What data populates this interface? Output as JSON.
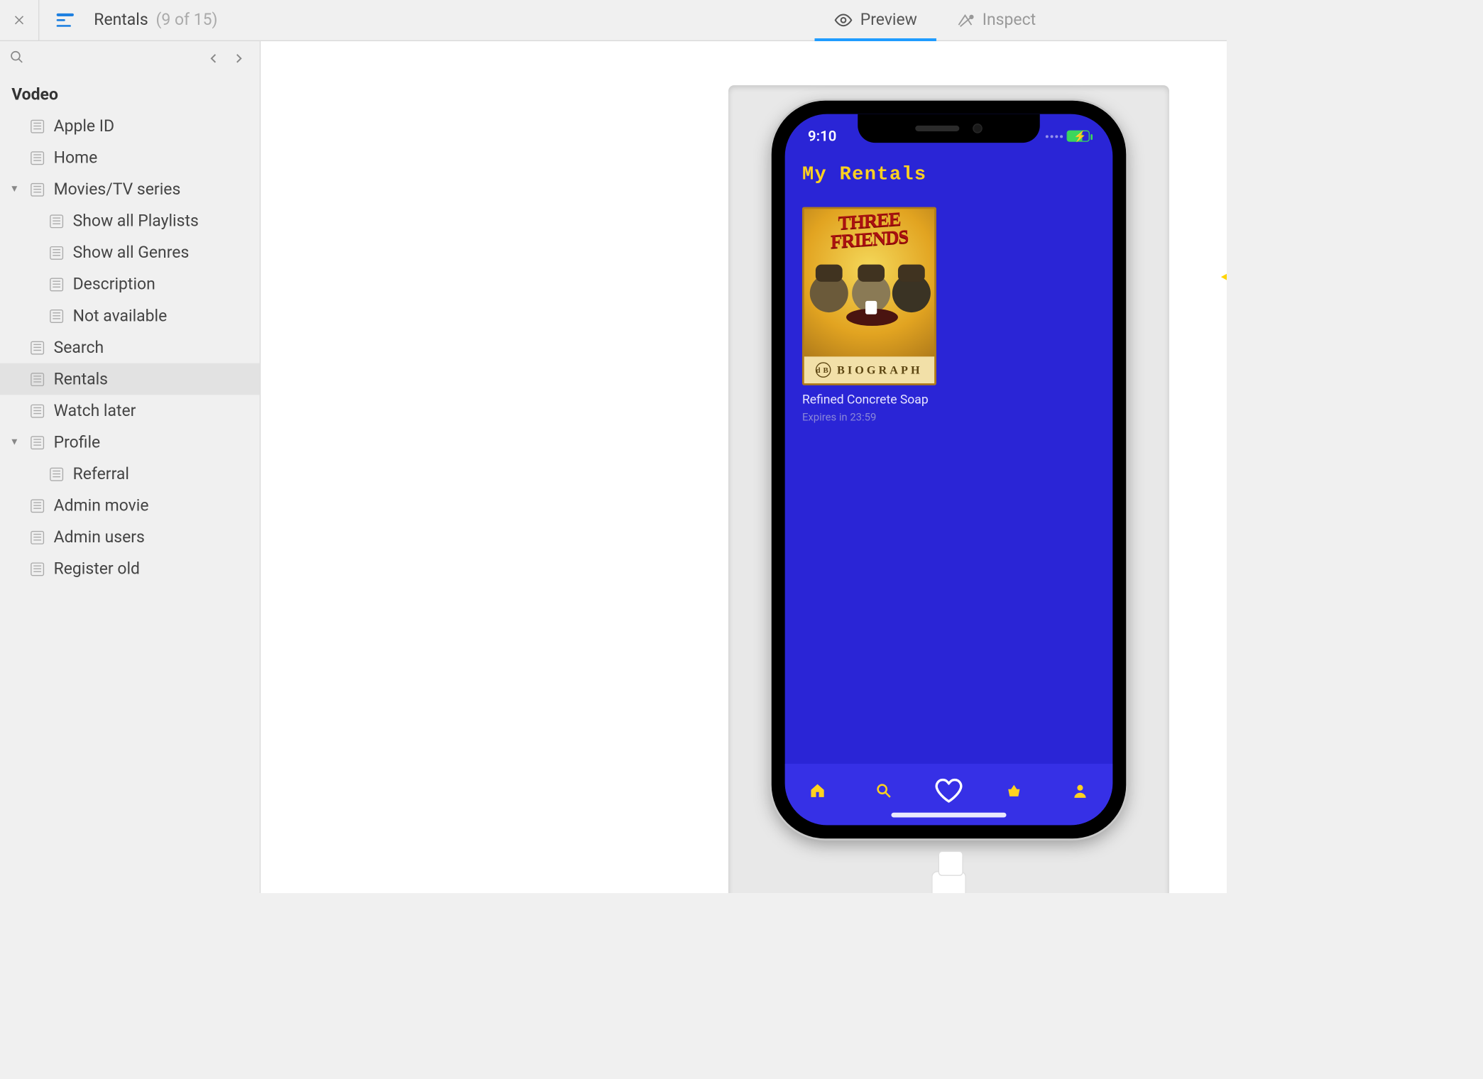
{
  "topbar": {
    "title": "Rentals",
    "count": "(9 of 15)",
    "tabs": {
      "preview": "Preview",
      "inspect": "Inspect"
    }
  },
  "tree": {
    "project": "Vodeo",
    "items": [
      {
        "label": "Apple ID",
        "indent": 0,
        "group": false
      },
      {
        "label": "Home",
        "indent": 0,
        "group": false
      },
      {
        "label": "Movies/TV series",
        "indent": 0,
        "group": true,
        "open": true
      },
      {
        "label": "Show all Playlists",
        "indent": 1,
        "group": false
      },
      {
        "label": "Show all Genres",
        "indent": 1,
        "group": false
      },
      {
        "label": "Description",
        "indent": 1,
        "group": false
      },
      {
        "label": "Not available",
        "indent": 1,
        "group": false
      },
      {
        "label": "Search",
        "indent": 0,
        "group": false
      },
      {
        "label": "Rentals",
        "indent": 0,
        "group": false,
        "selected": true
      },
      {
        "label": "Watch later",
        "indent": 0,
        "group": false
      },
      {
        "label": "Profile",
        "indent": 0,
        "group": true,
        "open": true
      },
      {
        "label": "Referral",
        "indent": 1,
        "group": false
      },
      {
        "label": "Admin movie",
        "indent": 0,
        "group": false
      },
      {
        "label": "Admin users",
        "indent": 0,
        "group": false
      },
      {
        "label": "Register old",
        "indent": 0,
        "group": false
      }
    ]
  },
  "phone": {
    "time": "9:10",
    "screen_title": "My Rentals",
    "card": {
      "poster_title_line1": "THREE",
      "poster_title_line2": "FRIENDS",
      "poster_studio": "BIOGRAPH",
      "title": "Refined Concrete Soap",
      "subtitle": "Expires in 23:59"
    },
    "tabbar": {
      "home": "home-icon",
      "search": "search-icon",
      "favorites": "heart-icon",
      "store": "store-icon",
      "profile": "profile-icon"
    }
  }
}
